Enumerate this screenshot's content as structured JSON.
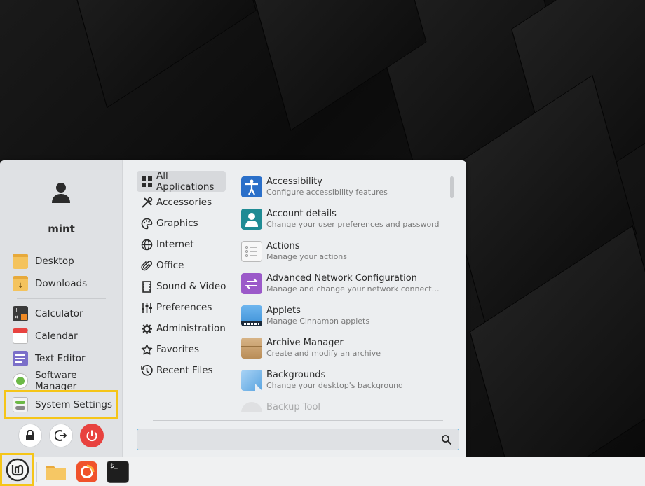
{
  "menu": {
    "user_name": "mint",
    "places": [
      {
        "label": "Desktop",
        "icon": "folder-icon"
      },
      {
        "label": "Downloads",
        "icon": "folder-download-icon"
      }
    ],
    "favorites": [
      {
        "label": "Calculator",
        "icon": "calculator-icon"
      },
      {
        "label": "Calendar",
        "icon": "calendar-icon"
      },
      {
        "label": "Text Editor",
        "icon": "text-editor-icon"
      },
      {
        "label": "Software Manager",
        "icon": "software-manager-icon"
      },
      {
        "label": "System Settings",
        "icon": "system-settings-icon"
      }
    ],
    "session_buttons": [
      "lock-icon",
      "logout-icon",
      "power-icon"
    ],
    "categories": [
      {
        "label": "All Applications",
        "icon": "grid-icon",
        "selected": true
      },
      {
        "label": "Accessories",
        "icon": "tools-icon"
      },
      {
        "label": "Graphics",
        "icon": "palette-icon"
      },
      {
        "label": "Internet",
        "icon": "globe-icon"
      },
      {
        "label": "Office",
        "icon": "paperclip-icon"
      },
      {
        "label": "Sound & Video",
        "icon": "film-icon"
      },
      {
        "label": "Preferences",
        "icon": "sliders-icon"
      },
      {
        "label": "Administration",
        "icon": "gear-icon"
      },
      {
        "label": "Favorites",
        "icon": "star-icon"
      },
      {
        "label": "Recent Files",
        "icon": "history-icon"
      }
    ],
    "apps": [
      {
        "name": "Accessibility",
        "desc": "Configure accessibility features",
        "icon": "accessibility-icon"
      },
      {
        "name": "Account details",
        "desc": "Change your user preferences and password",
        "icon": "account-icon"
      },
      {
        "name": "Actions",
        "desc": "Manage your actions",
        "icon": "actions-icon"
      },
      {
        "name": "Advanced Network Configuration",
        "desc": "Manage and change your network connection se…",
        "icon": "network-config-icon"
      },
      {
        "name": "Applets",
        "desc": "Manage Cinnamon applets",
        "icon": "applets-icon"
      },
      {
        "name": "Archive Manager",
        "desc": "Create and modify an archive",
        "icon": "archive-icon"
      },
      {
        "name": "Backgrounds",
        "desc": "Change your desktop's background",
        "icon": "backgrounds-icon"
      },
      {
        "name": "Backup Tool",
        "desc": "",
        "icon": "backup-icon"
      }
    ],
    "search": {
      "value": "",
      "placeholder": ""
    }
  },
  "taskbar": {
    "items": [
      "mint-menu-icon",
      "files-icon",
      "firefox-icon",
      "terminal-icon"
    ],
    "terminal_glyph": "$_"
  },
  "colors": {
    "accent": "#3daee9",
    "highlight": "#f5c518",
    "power": "#e8423f",
    "mint_green": "#6cb946"
  }
}
